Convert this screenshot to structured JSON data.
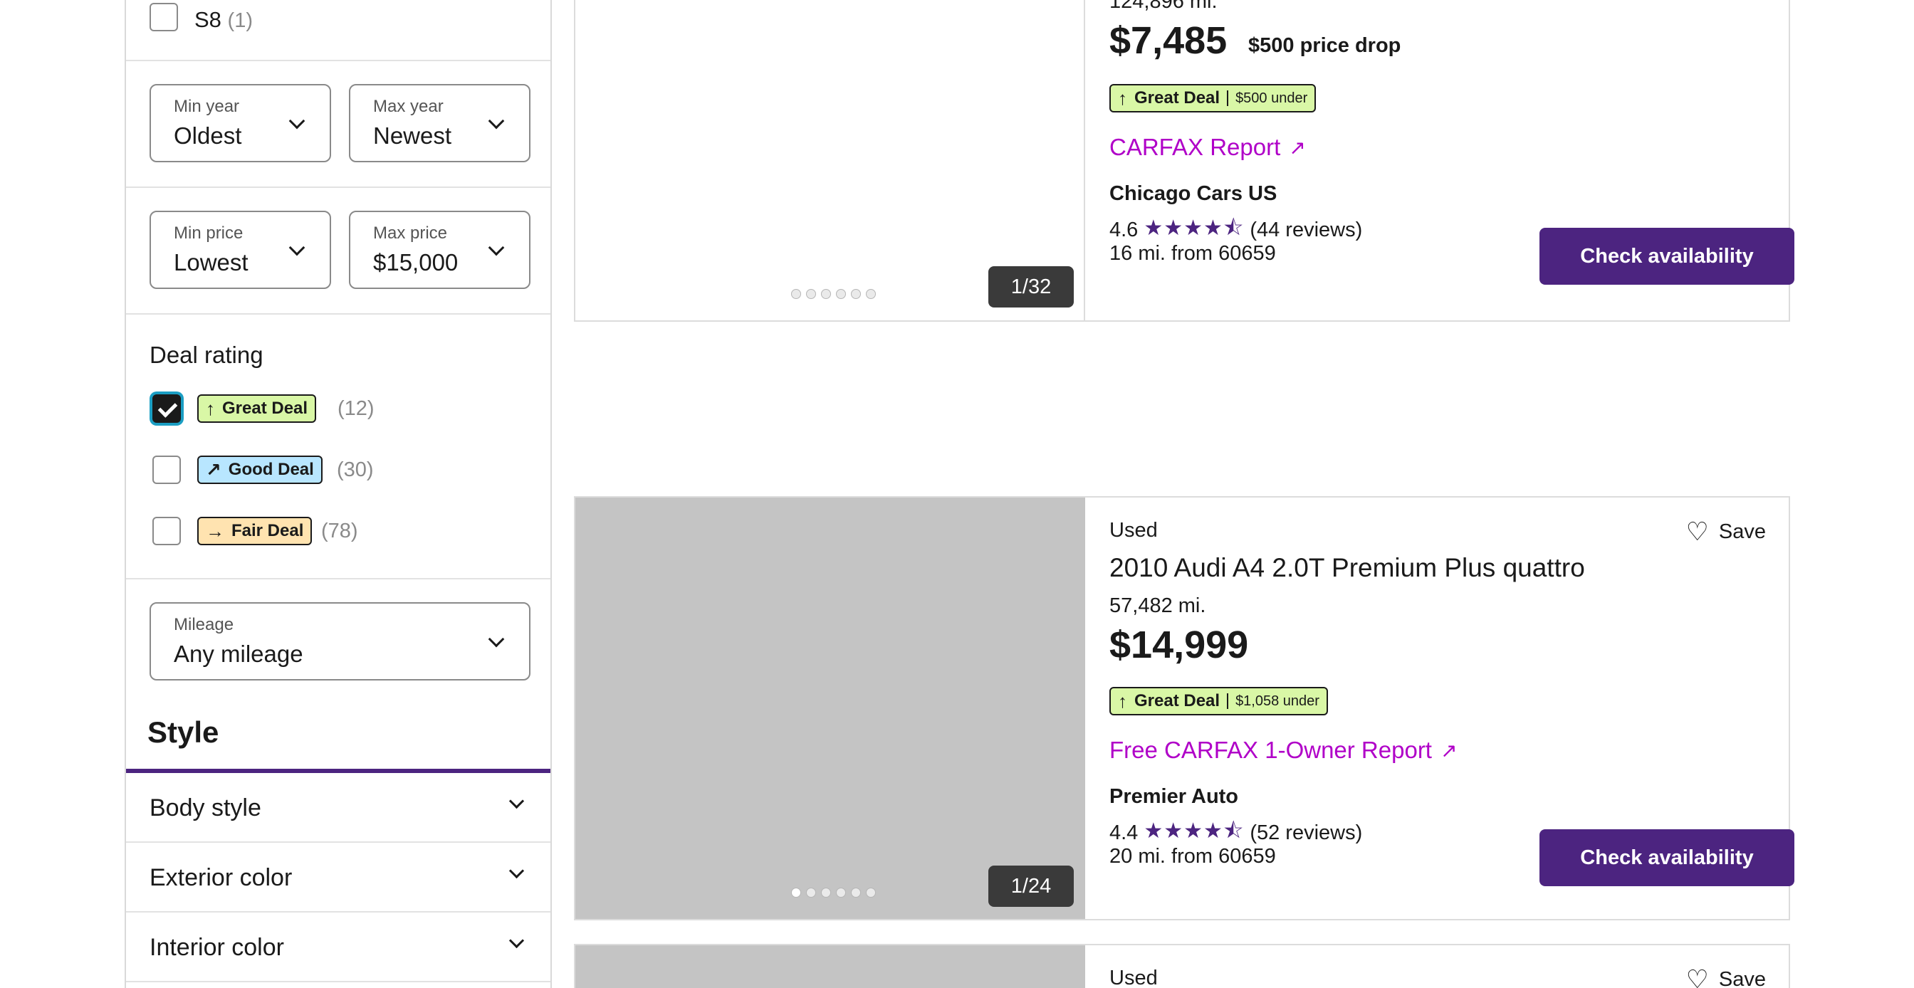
{
  "filters": {
    "model_option": {
      "label": "S8",
      "count": "(1)"
    },
    "year": {
      "min": {
        "label": "Min year",
        "value": "Oldest"
      },
      "max": {
        "label": "Max year",
        "value": "Newest"
      }
    },
    "price": {
      "min": {
        "label": "Min price",
        "value": "Lowest"
      },
      "max": {
        "label": "Max price",
        "value": "$15,000"
      }
    },
    "deal_rating": {
      "title": "Deal rating",
      "options": [
        {
          "label": "Great Deal",
          "count": "(12)",
          "checked": true,
          "icon": "arrow-up-icon",
          "color": "#d9f7a6"
        },
        {
          "label": "Good Deal",
          "count": "(30)",
          "checked": false,
          "icon": "arrow-up-right-icon",
          "color": "#b8e6ff"
        },
        {
          "label": "Fair Deal",
          "count": "(78)",
          "checked": false,
          "icon": "arrow-right-icon",
          "color": "#ffe3b0"
        }
      ]
    },
    "mileage": {
      "label": "Mileage",
      "value": "Any mileage"
    },
    "style": {
      "title": "Style",
      "sections": [
        "Body style",
        "Exterior color",
        "Interior color"
      ]
    }
  },
  "listings": [
    {
      "mileage": "124,896 mi.",
      "price": "$7,485",
      "price_drop": "$500 price drop",
      "deal": {
        "label": "Great Deal",
        "detail": "$500 under"
      },
      "carfax": "CARFAX Report",
      "dealer": "Chicago Cars US",
      "rating": "4.6",
      "stars": "★★★★⯪",
      "reviews": "(44 reviews)",
      "distance": "16 mi. from 60659",
      "photo_counter": "1/32",
      "cta": "Check availability"
    },
    {
      "condition": "Used",
      "title": "2010 Audi A4 2.0T Premium Plus quattro",
      "mileage": "57,482 mi.",
      "price": "$14,999",
      "deal": {
        "label": "Great Deal",
        "detail": "$1,058 under"
      },
      "carfax": "Free CARFAX 1-Owner Report",
      "dealer": "Premier Auto",
      "rating": "4.4",
      "stars": "★★★★⯪",
      "reviews": "(52 reviews)",
      "distance": "20 mi. from 60659",
      "photo_counter": "1/24",
      "cta": "Check availability",
      "save": "Save"
    },
    {
      "condition": "Used",
      "save": "Save"
    }
  ],
  "colors": {
    "brand_purple": "#4c2480",
    "carfax_link": "#b000c8",
    "great_deal": "#d9f7a6",
    "good_deal": "#b8e6ff",
    "fair_deal": "#ffe3b0"
  }
}
